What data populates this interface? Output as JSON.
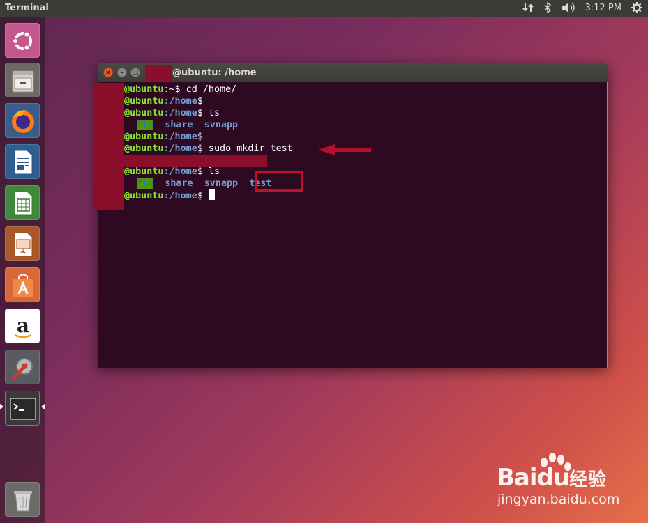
{
  "top_panel": {
    "app_title": "Terminal",
    "time": "3:12 PM"
  },
  "launcher": {
    "items": [
      {
        "name": "ubuntu-dash",
        "icon": "ubuntu-logo-icon"
      },
      {
        "name": "files",
        "icon": "file-cabinet-icon"
      },
      {
        "name": "firefox",
        "icon": "firefox-icon"
      },
      {
        "name": "libreoffice-writer",
        "icon": "writer-document-icon"
      },
      {
        "name": "libreoffice-calc",
        "icon": "calc-spreadsheet-icon"
      },
      {
        "name": "libreoffice-impress",
        "icon": "impress-presentation-icon"
      },
      {
        "name": "software-center",
        "icon": "shopping-bag-icon"
      },
      {
        "name": "amazon",
        "icon": "amazon-icon"
      },
      {
        "name": "system-settings",
        "icon": "settings-wrench-gear-icon"
      },
      {
        "name": "terminal",
        "icon": "terminal-icon"
      },
      {
        "name": "trash",
        "icon": "trash-icon"
      }
    ]
  },
  "window": {
    "title": "@ubuntu: /home"
  },
  "terminal": {
    "host": "@ubuntu",
    "lines": [
      {
        "path": ":~$",
        "cmd": " cd /home/"
      },
      {
        "path": ":/home",
        "cmd": ""
      },
      {
        "path": ":/home",
        "cmd": " ls"
      },
      {
        "path": ":/home",
        "cmd": ""
      },
      {
        "path": ":/home",
        "cmd": " sudo mkdir test"
      },
      {
        "path": ":/home",
        "cmd": " ls"
      },
      {
        "path": ":/home",
        "cmd": " "
      }
    ],
    "ls1": [
      "ftp",
      "share",
      "svnapp"
    ],
    "ls2": [
      "ftp",
      "share",
      "svnapp",
      "test"
    ]
  },
  "watermark": {
    "brand": "Bai",
    "brand_du": "du",
    "brand_cn": "经验",
    "url": "jingyan.baidu.com"
  },
  "colors": {
    "prompt_user": "#8ae234",
    "prompt_path": "#729fcf",
    "terminal_bg": "#2d0a22",
    "annotation_red": "#c0102c"
  }
}
